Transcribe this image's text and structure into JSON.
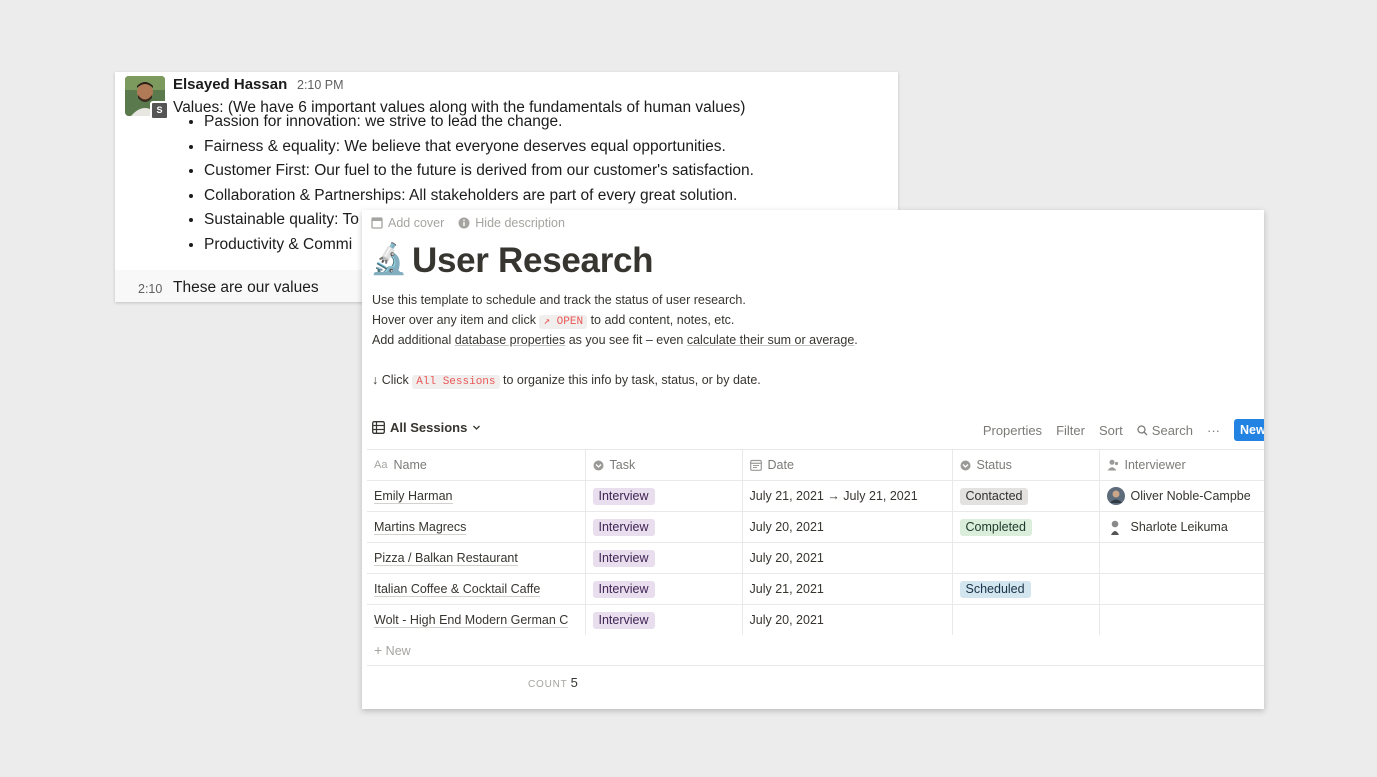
{
  "slack": {
    "sender": "Elsayed Hassan",
    "time": "2:10 PM",
    "badge": "S",
    "message": "Values: (We have 6 important values along with the fundamentals of human values)",
    "bullets": [
      "Passion for innovation: we strive to lead the change.",
      "Fairness & equality: We believe that everyone deserves equal opportunities.",
      "Customer First: Our fuel to the future is derived from our customer's satisfaction.",
      "Collaboration & Partnerships: All stakeholders are part of every great solution.",
      "Sustainable quality: To",
      "Productivity & Commi"
    ],
    "followup_time": "2:10",
    "followup_text": "These are our values"
  },
  "notion": {
    "add_cover": "Add cover",
    "hide_description": "Hide description",
    "emoji": "🔬",
    "title": "User Research",
    "desc": {
      "line1": "Use this template to schedule and track the status of user research.",
      "line2_a": "Hover over any item and click",
      "line2_code": "↗ OPEN",
      "line2_b": "to add content, notes, etc.",
      "line3_a": "Add additional",
      "line3_link1": "database properties",
      "line3_b": "as you see fit – even",
      "line3_link2": "calculate their sum or average",
      "line3_c": ".",
      "line4_a": "↓ Click",
      "line4_code": "All Sessions",
      "line4_b": "to organize this info by task, status, or by date."
    },
    "view": {
      "name": "All Sessions",
      "properties": "Properties",
      "filter": "Filter",
      "sort": "Sort",
      "search": "Search",
      "more": "···",
      "new": "New"
    },
    "columns": {
      "name": "Name",
      "task": "Task",
      "date": "Date",
      "status": "Status",
      "interviewer": "Interviewer"
    },
    "rows": [
      {
        "name": "Emily Harman",
        "task": "Interview",
        "date": "July 21, 2021 → July 21, 2021",
        "status": "Contacted",
        "interviewer": "Oliver Noble-Campbe"
      },
      {
        "name": "Martins Magrecs",
        "task": "Interview",
        "date": "July 20, 2021",
        "status": "Completed",
        "interviewer": "Sharlote Leikuma"
      },
      {
        "name": "Pizza / Balkan Restaurant",
        "task": "Interview",
        "date": "July 20, 2021",
        "status": "",
        "interviewer": ""
      },
      {
        "name": "Italian Coffee & Cocktail Caffe",
        "task": "Interview",
        "date": "July 21, 2021",
        "status": "Scheduled",
        "interviewer": ""
      },
      {
        "name": "Wolt - High End Modern German C",
        "task": "Interview",
        "date": "July 20, 2021",
        "status": "",
        "interviewer": ""
      }
    ],
    "new_row": "New",
    "count_label": "COUNT",
    "count_value": "5"
  }
}
